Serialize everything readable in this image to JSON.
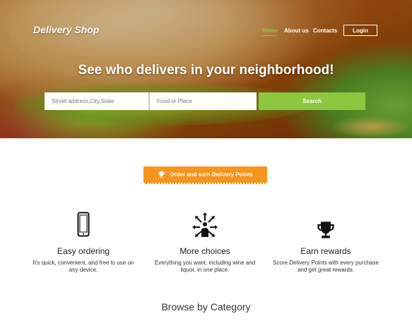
{
  "header": {
    "brand": "Delivery Shop",
    "nav": [
      "Home",
      "About us",
      "Contacts"
    ],
    "login_label": "Login"
  },
  "hero": {
    "headline": "See who delivers in your neighborhood!",
    "address_placeholder": "Street address,City,State",
    "food_placeholder": "Food or Place",
    "search_label": "Search"
  },
  "order": {
    "label": "Order and earn Delivery Points"
  },
  "features": [
    {
      "icon": "smartphone-icon",
      "title": "Easy ordering",
      "text": "It's quick, convenient, and free to use on any device."
    },
    {
      "icon": "person-arrows-icon",
      "title": "More choices",
      "text": "Everything you want, including wine and liquor, in one place."
    },
    {
      "icon": "trophy-icon",
      "title": "Earn rewards",
      "text": "Score Delivery Points with every purchase and get great rewards."
    }
  ],
  "browse": {
    "title": "Browse by Category"
  },
  "colors": {
    "accent_green": "#8dc63f",
    "accent_orange": "#f7941d"
  }
}
